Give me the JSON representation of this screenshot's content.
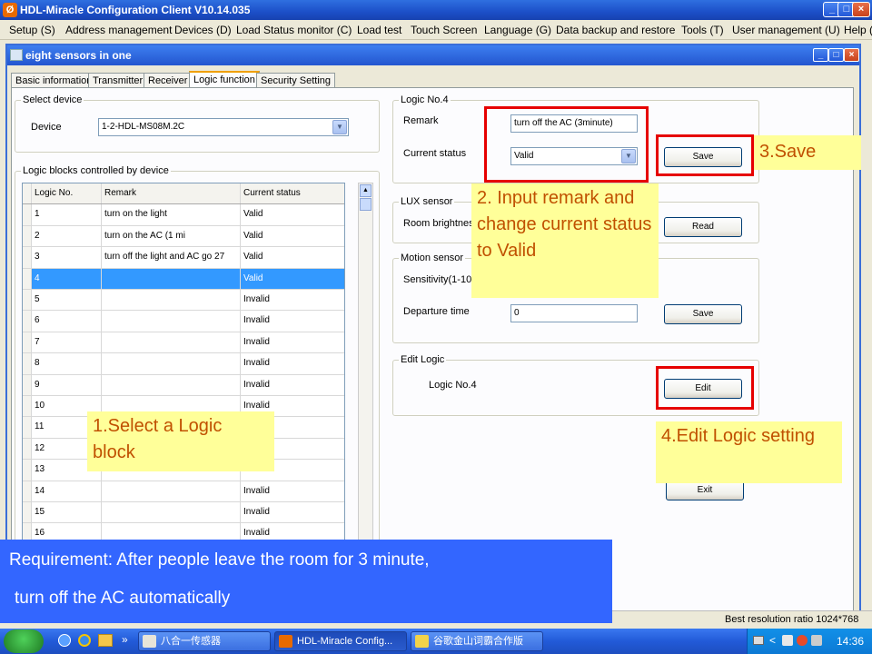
{
  "app": {
    "title": "HDL-Miracle Configuration Client V10.14.035",
    "logo_glyph": "Ø",
    "minimize": "_",
    "maximize": "□",
    "close": "×"
  },
  "menu": [
    "Setup (S)",
    "Address management",
    "Devices (D)",
    "Load Status monitor (C)",
    "Load test",
    "Touch Screen",
    "Language (G)",
    "Data backup and restore",
    "Tools (T)",
    "User management (U)",
    "Help ("
  ],
  "child_window": {
    "title": "eight sensors in one",
    "minimize": "_",
    "maximize": "□",
    "close": "×"
  },
  "tabs": [
    "Basic information",
    "Transmitter",
    "Receiver",
    "Logic function",
    "Security Setting"
  ],
  "active_tab": "Logic function",
  "select_device": {
    "group_label": "Select device",
    "device_label": "Device",
    "device_value": "1-2-HDL-MS08M.2C"
  },
  "logic_blocks": {
    "group_label": "Logic blocks controlled by device",
    "columns": [
      "Logic No.",
      "Remark",
      "Current status"
    ],
    "selected_row": 4,
    "rows": [
      {
        "no": "1",
        "remark": "turn on the light",
        "status": "Valid"
      },
      {
        "no": "2",
        "remark": "turn on the AC (1 mi",
        "status": "Valid"
      },
      {
        "no": "3",
        "remark": "turn off the light and AC go 27",
        "status": "Valid"
      },
      {
        "no": "4",
        "remark": "",
        "status": "Valid"
      },
      {
        "no": "5",
        "remark": "",
        "status": "Invalid"
      },
      {
        "no": "6",
        "remark": "",
        "status": "Invalid"
      },
      {
        "no": "7",
        "remark": "",
        "status": "Invalid"
      },
      {
        "no": "8",
        "remark": "",
        "status": "Invalid"
      },
      {
        "no": "9",
        "remark": "",
        "status": "Invalid"
      },
      {
        "no": "10",
        "remark": "",
        "status": "Invalid"
      },
      {
        "no": "11",
        "remark": "",
        "status": "Invalid"
      },
      {
        "no": "12",
        "remark": "",
        "status": "Invalid"
      },
      {
        "no": "13",
        "remark": "",
        "status": "Invalid"
      },
      {
        "no": "14",
        "remark": "",
        "status": "Invalid"
      },
      {
        "no": "15",
        "remark": "",
        "status": "Invalid"
      },
      {
        "no": "16",
        "remark": "",
        "status": "Invalid"
      }
    ]
  },
  "logic_panel": {
    "group_label": "Logic No.4",
    "remark_label": "Remark",
    "remark_value": "turn off the AC (3minute)",
    "status_label": "Current status",
    "status_value": "Valid",
    "save_label": "Save"
  },
  "lux_sensor": {
    "group_label": "LUX sensor",
    "brightness_label": "Room brightness",
    "read_label": "Read"
  },
  "motion_sensor": {
    "group_label": "Motion sensor",
    "sensitivity_label": "Sensitivity(1-100)",
    "departure_label": "Departure time",
    "departure_value": "0",
    "save_label": "Save"
  },
  "edit_logic": {
    "group_label": "Edit Logic",
    "logic_label": "Logic No.4",
    "edit_label": "Edit"
  },
  "exit_label": "Exit",
  "annotations": {
    "step1": "1.Select a Logic block",
    "step2": "2. Input remark and change current status to Valid",
    "step3": "3.Save",
    "step4": "4.Edit Logic setting",
    "requirement_line1": "Requirement:  After people leave the room for 3 minute,",
    "requirement_line2": "turn off the AC automatically"
  },
  "statusbar": {
    "resolution": "Best resolution ratio 1024*768"
  },
  "taskbar": {
    "items": [
      "八合一传感器",
      "HDL-Miracle Config...",
      "谷歌金山词霸合作版"
    ],
    "overflow": "»",
    "clock": "14:36"
  },
  "colors": {
    "annotation_red": "#e60000",
    "note_yellow": "#ffff99",
    "requirement_blue": "#3366ff",
    "selection_blue": "#3399ff"
  }
}
